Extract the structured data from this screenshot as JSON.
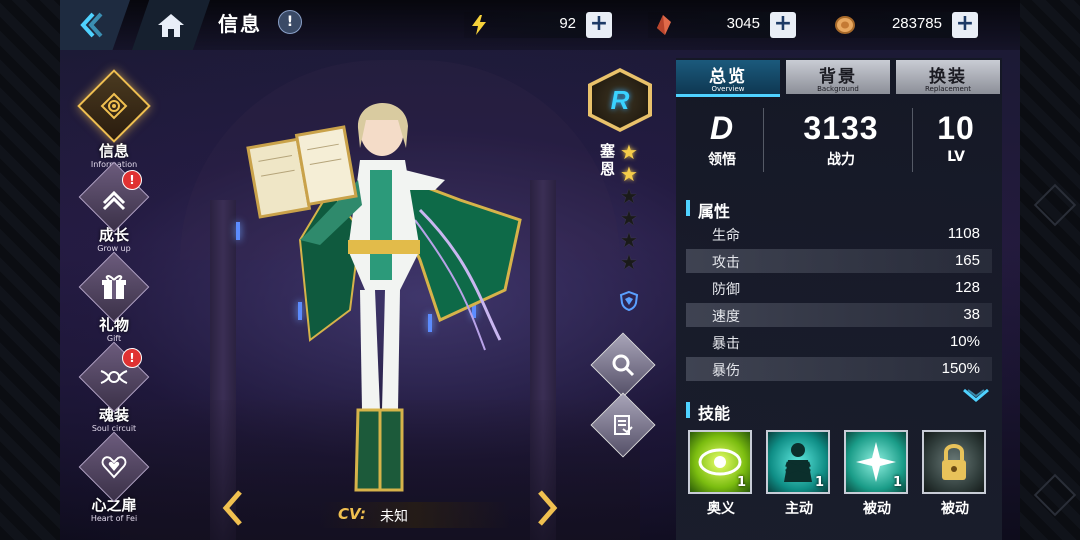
{
  "header": {
    "title": "信息",
    "resources": [
      {
        "icon": "energy-icon",
        "value": "92"
      },
      {
        "icon": "crystal-icon",
        "value": "3045"
      },
      {
        "icon": "coin-icon",
        "value": "283785"
      }
    ]
  },
  "menu": [
    {
      "label": "信息",
      "sub": "Information",
      "active": true,
      "alert": false
    },
    {
      "label": "成长",
      "sub": "Grow up",
      "active": false,
      "alert": true
    },
    {
      "label": "礼物",
      "sub": "Gift",
      "active": false,
      "alert": false
    },
    {
      "label": "魂装",
      "sub": "Soul circuit",
      "active": false,
      "alert": true
    },
    {
      "label": "心之扉",
      "sub": "Heart of Fei",
      "active": false,
      "alert": false
    }
  ],
  "badge_symbol": "!",
  "character": {
    "name": "塞恩",
    "rank": "R",
    "stars_filled": 2,
    "stars_total": 6,
    "cv_label": "CV:",
    "cv_value": "未知"
  },
  "tabs": [
    {
      "label": "总览",
      "sub": "Overview",
      "active": true
    },
    {
      "label": "背景",
      "sub": "Background",
      "active": false
    },
    {
      "label": "换装",
      "sub": "Replacement",
      "active": false
    }
  ],
  "summary": {
    "comprehension": {
      "value": "D",
      "label": "领悟"
    },
    "power": {
      "value": "3133",
      "label": "战力"
    },
    "level": {
      "value": "10",
      "label": "LV"
    }
  },
  "attributes": {
    "heading": "属性",
    "rows": [
      {
        "name": "生命",
        "value": "1108"
      },
      {
        "name": "攻击",
        "value": "165"
      },
      {
        "name": "防御",
        "value": "128"
      },
      {
        "name": "速度",
        "value": "38"
      },
      {
        "name": "暴击",
        "value": "10%"
      },
      {
        "name": "暴伤",
        "value": "150%"
      }
    ]
  },
  "skills": {
    "heading": "技能",
    "items": [
      {
        "label": "奥义",
        "level": "1",
        "color": "#9bd21a"
      },
      {
        "label": "主动",
        "level": "1",
        "color": "#13a8a0"
      },
      {
        "label": "被动",
        "level": "1",
        "color": "#1f9c8c"
      },
      {
        "label": "被动",
        "level": "",
        "color": "#3a4a48"
      }
    ]
  },
  "colors": {
    "accent": "#4fd2ff",
    "gold": "#f0c050",
    "alert": "#e03232"
  }
}
